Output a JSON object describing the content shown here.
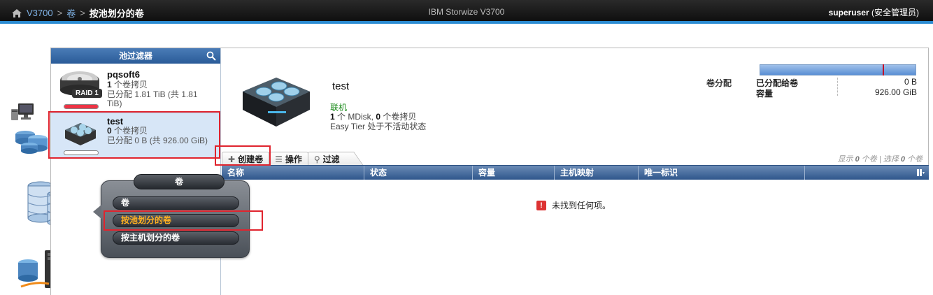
{
  "topbar": {
    "home_icon": "home-icon",
    "crumbs": [
      "V3700",
      "卷",
      "按池划分的卷"
    ],
    "separator": ">",
    "product": "IBM Storwize V3700",
    "user_name": "superuser",
    "user_role": "(安全管理员)"
  },
  "pool_filter": {
    "title": "池过滤器",
    "search_icon": "search-icon",
    "pools": [
      {
        "name": "pqsoft6",
        "badge": "RAID 1",
        "copies_count": "1",
        "copies_label": " 个卷拷贝",
        "alloc_prefix": "已分配 ",
        "alloc_text": "1.81 TiB (共 1.81 TiB)",
        "usage": 1.0,
        "selected": false
      },
      {
        "name": "test",
        "copies_count": "0",
        "copies_label": " 个卷拷贝",
        "alloc_prefix": "已分配 ",
        "alloc_text": "0 B (共 926.00 GiB)",
        "usage": 0.0,
        "selected": true
      }
    ]
  },
  "detail": {
    "name": "test",
    "status": "联机",
    "mdisk_count": "1",
    "mdisk_label": " 个 MDisk, ",
    "copies_count": "0",
    "copies_label": " 个卷拷贝",
    "easy_tier": "Easy Tier 处于不活动状态",
    "allocation_title": "卷分配",
    "allocated_label": "已分配给卷",
    "allocated_value": "0 B",
    "capacity_label": "容量",
    "capacity_value": "926.00 GiB",
    "alloc_bar_marker_fraction": 0.79
  },
  "toolbar": {
    "create": "创建卷",
    "actions": "操作",
    "filter": "过滤"
  },
  "showing": {
    "prefix": "显示 ",
    "shown": "0",
    "mid": " 个卷 | 选择 ",
    "selected": "0",
    "suffix": " 个卷"
  },
  "table": {
    "columns": [
      "名称",
      "状态",
      "容量",
      "主机映射",
      "唯一标识"
    ],
    "empty_message": "未找到任何项。"
  },
  "popup_menu": {
    "title": "卷",
    "items": [
      "卷",
      "按池划分的卷",
      "按主机划分的卷"
    ],
    "active_index": 1
  },
  "colors": {
    "accent": "#2b8bd1",
    "status_ok": "#1a8a1a",
    "highlight": "#e0242e",
    "menu_active": "#ffb020"
  }
}
